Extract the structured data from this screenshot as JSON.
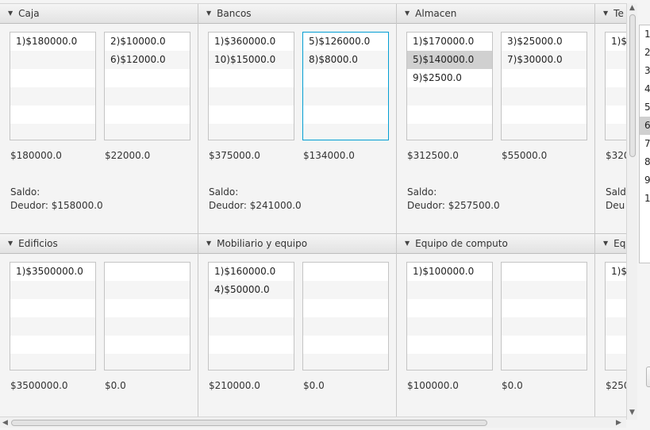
{
  "panels": [
    {
      "title": "Caja",
      "debits": [
        "1)$180000.0"
      ],
      "credits": [
        "2)$10000.0",
        "6)$12000.0"
      ],
      "debit_total": "$180000.0",
      "credit_total": "$22000.0",
      "saldo_label": "Saldo:",
      "saldo_value": "Deudor: $158000.0",
      "selected_debit_index": -1,
      "selected_credit_index": -1
    },
    {
      "title": "Bancos",
      "debits": [
        "1)$360000.0",
        "10)$15000.0"
      ],
      "credits": [
        "5)$126000.0",
        "8)$8000.0"
      ],
      "debit_total": "$375000.0",
      "credit_total": "$134000.0",
      "saldo_label": "Saldo:",
      "saldo_value": "Deudor: $241000.0",
      "selected_debit_index": -1,
      "selected_credit_index": -1,
      "focused_list": "credit"
    },
    {
      "title": "Almacen",
      "debits": [
        "1)$170000.0",
        "5)$140000.0",
        "9)$2500.0"
      ],
      "credits": [
        "3)$25000.0",
        "7)$30000.0"
      ],
      "debit_total": "$312500.0",
      "credit_total": "$55000.0",
      "saldo_label": "Saldo:",
      "saldo_value": "Deudor: $257500.0",
      "selected_debit_index": 1,
      "selected_credit_index": -1
    },
    {
      "title": "Te",
      "debits": [
        "1)$"
      ],
      "credits": [],
      "debit_total": "$320",
      "credit_total": "",
      "saldo_label": "Saldo",
      "saldo_value": "Deu",
      "selected_debit_index": -1,
      "selected_credit_index": -1
    },
    {
      "title": "Edificios",
      "debits": [
        "1)$3500000.0"
      ],
      "credits": [],
      "debit_total": "$3500000.0",
      "credit_total": "$0.0",
      "saldo_label": "",
      "saldo_value": "",
      "selected_debit_index": -1,
      "selected_credit_index": -1
    },
    {
      "title": "Mobiliario y equipo",
      "debits": [
        "1)$160000.0",
        "4)$50000.0"
      ],
      "credits": [],
      "debit_total": "$210000.0",
      "credit_total": "$0.0",
      "saldo_label": "",
      "saldo_value": "",
      "selected_debit_index": -1,
      "selected_credit_index": -1
    },
    {
      "title": "Equipo de computo",
      "debits": [
        "1)$100000.0"
      ],
      "credits": [],
      "debit_total": "$100000.0",
      "credit_total": "$0.0",
      "saldo_label": "",
      "saldo_value": "",
      "selected_debit_index": -1,
      "selected_credit_index": -1
    },
    {
      "title": "Eq",
      "debits": [
        "1)$"
      ],
      "credits": [],
      "debit_total": "$250",
      "credit_total": "",
      "saldo_label": "",
      "saldo_value": "",
      "selected_debit_index": -1,
      "selected_credit_index": -1
    }
  ],
  "side_list": {
    "items": [
      "1",
      "2",
      "3",
      "4",
      "5",
      "6",
      "7",
      "8",
      "9",
      "1"
    ],
    "selected_index": 5
  },
  "icons": {
    "collapse": "triangle-down-icon",
    "scroll_up": "chevron-up-icon",
    "scroll_down": "chevron-down-icon",
    "scroll_left": "chevron-left-icon",
    "scroll_right": "chevron-right-icon"
  },
  "colors": {
    "focus_border": "#039ed3",
    "selection": "#d0d0d0"
  }
}
